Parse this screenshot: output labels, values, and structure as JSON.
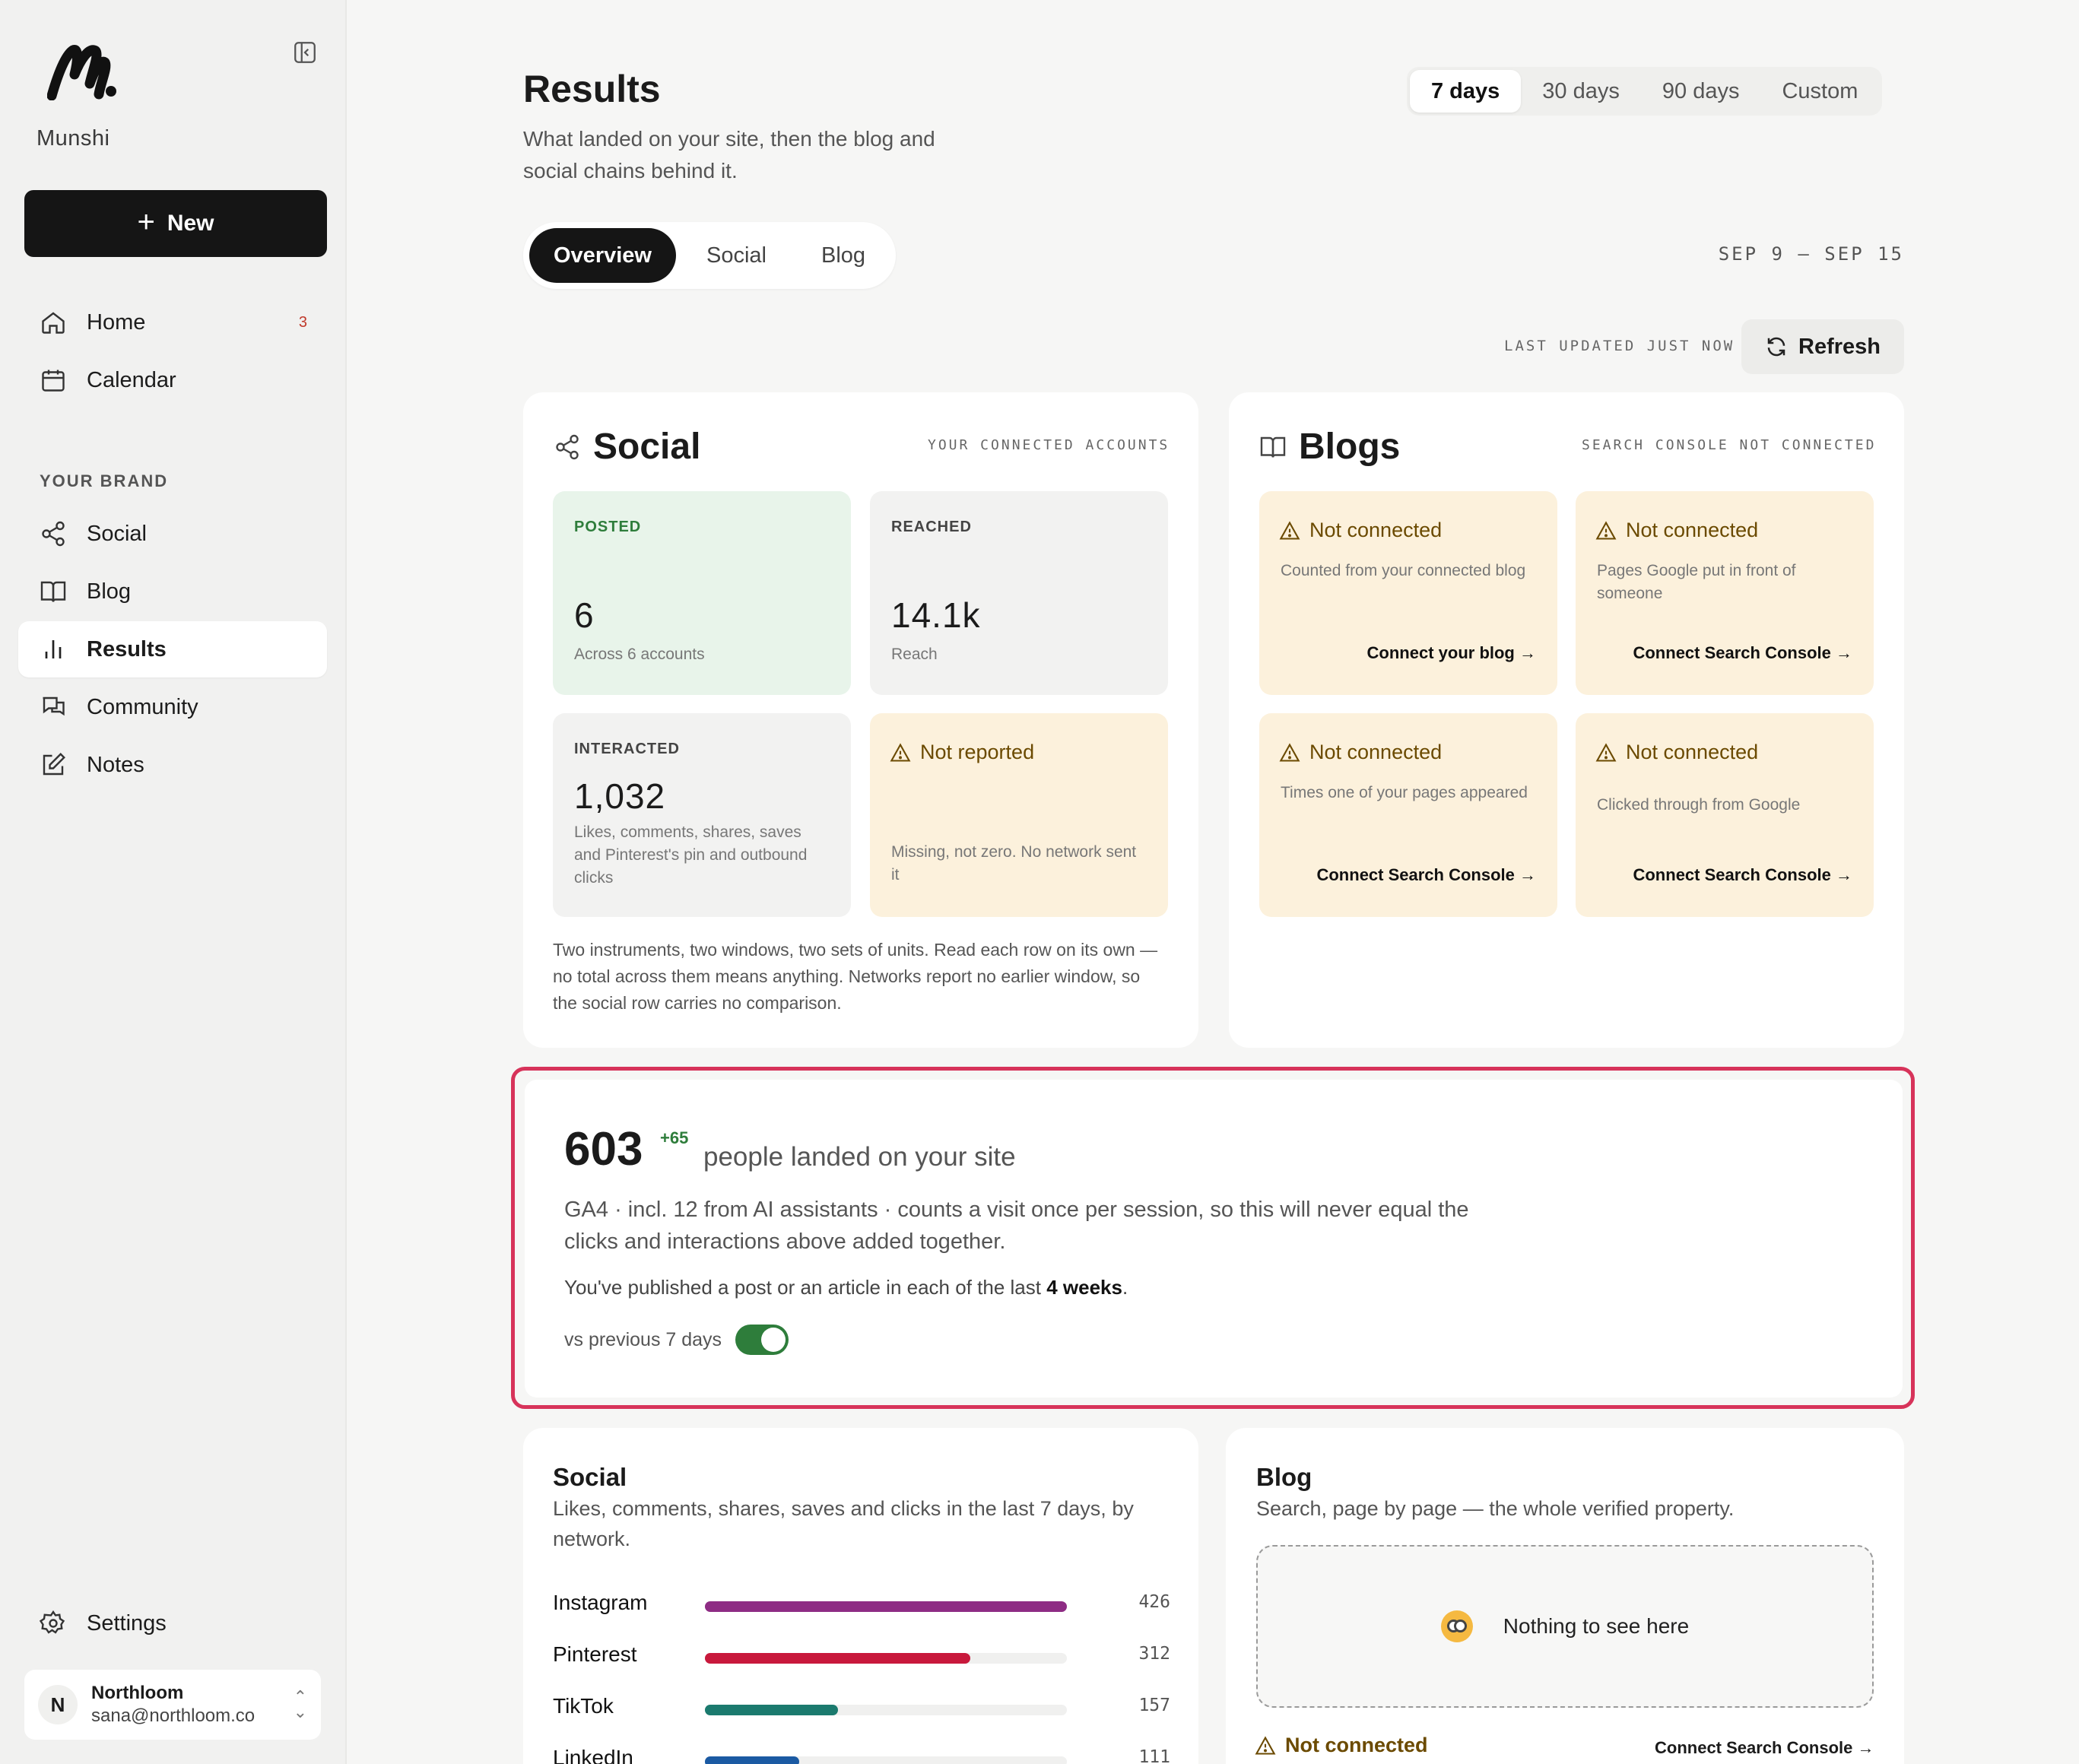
{
  "sidebar": {
    "brand": "Munshi",
    "new_label": "New",
    "nav": [
      {
        "label": "Home",
        "badge": "3"
      },
      {
        "label": "Calendar"
      }
    ],
    "section_label": "YOUR BRAND",
    "brand_nav": [
      {
        "label": "Social"
      },
      {
        "label": "Blog"
      },
      {
        "label": "Results"
      },
      {
        "label": "Community"
      },
      {
        "label": "Notes"
      }
    ],
    "settings_label": "Settings",
    "account": {
      "initial": "N",
      "name": "Northloom",
      "email": "sana@northloom.co"
    }
  },
  "header": {
    "title": "Results",
    "subtitle": "What landed on your site, then the blog and social chains behind it.",
    "ranges": [
      "7 days",
      "30 days",
      "90 days",
      "Custom"
    ],
    "active_range": "7 days",
    "tabs": [
      "Overview",
      "Social",
      "Blog"
    ],
    "active_tab": "Overview",
    "date_range": "SEP 9 – SEP 15",
    "updated": "LAST UPDATED JUST NOW",
    "refresh_label": "Refresh"
  },
  "social_card": {
    "title": "Social",
    "meta": "YOUR CONNECTED ACCOUNTS",
    "posted": {
      "label": "POSTED",
      "value": "6",
      "note": "Across 6 accounts"
    },
    "reached": {
      "label": "REACHED",
      "value": "14.1k",
      "note": "Reach"
    },
    "interacted": {
      "label": "INTERACTED",
      "value": "1,032",
      "note": "Likes, comments, shares, saves and Pinterest's pin and outbound clicks"
    },
    "not_reported": {
      "title": "Not reported",
      "note": "Missing, not zero. No network sent it"
    },
    "footnote": "Two instruments, two windows, two sets of units. Read each row on its own — no total across them means anything. Networks report no earlier window, so the social row carries no comparison."
  },
  "blogs_card": {
    "title": "Blogs",
    "meta": "SEARCH CONSOLE NOT CONNECTED",
    "tiles": [
      {
        "title": "Not connected",
        "note": "Counted from your connected blog",
        "link": "Connect your blog →"
      },
      {
        "title": "Not connected",
        "note": "Pages Google put in front of someone",
        "link": "Connect Search Console →"
      },
      {
        "title": "Not connected",
        "note": "Times one of your pages appeared",
        "link": "Connect Search Console →"
      },
      {
        "title": "Not connected",
        "note": "Clicked through from Google",
        "link": "Connect Search Console →"
      }
    ]
  },
  "visits": {
    "value": "603",
    "delta": "+65",
    "caption": "people landed on your site",
    "desc": "GA4 · incl. 12 from AI assistants · counts a visit once per session, so this will never equal the clicks and interactions above added together.",
    "streak_prefix": "You've published a post or an article in each of the last ",
    "streak_bold": "4 weeks",
    "streak_suffix": ".",
    "toggle_label": "vs previous 7 days",
    "toggle_on": true
  },
  "social_breakdown": {
    "title": "Social",
    "subtitle": "Likes, comments, shares, saves and clicks in the last 7 days, by network.",
    "rows": [
      {
        "name": "Instagram",
        "value": 426,
        "color": "#8e2c84"
      },
      {
        "name": "Pinterest",
        "value": 312,
        "color": "#c8193c"
      },
      {
        "name": "TikTok",
        "value": 157,
        "color": "#1b7a6e"
      },
      {
        "name": "LinkedIn",
        "value": 111,
        "color": "#1b5aa3"
      }
    ],
    "max": 426
  },
  "blog_breakdown": {
    "title": "Blog",
    "subtitle": "Search, page by page — the whole verified property.",
    "empty": "Nothing to see here",
    "warn": "Not connected",
    "link": "Connect Search Console →"
  }
}
